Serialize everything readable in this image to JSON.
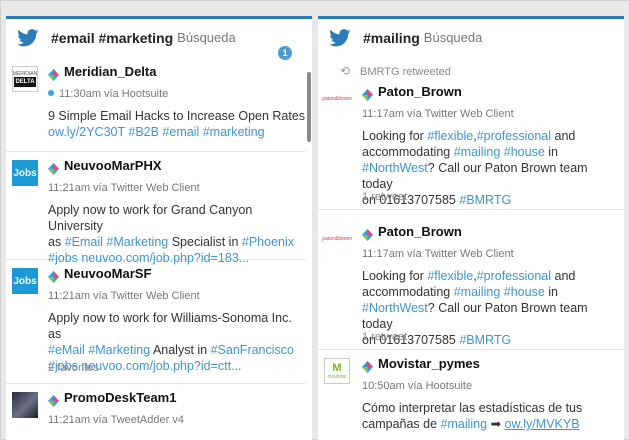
{
  "columns": [
    {
      "title": "#email #marketing",
      "subtitle": "Búsqueda",
      "badge": "1",
      "tweets": [
        {
          "author": "Meridian_Delta",
          "time": "11:30am vía Hootsuite",
          "body_plain": "9 Simple Email Hacks to Increase Open Rates ",
          "body_links": "ow.ly/2YC30T #B2B #email #marketing",
          "avatar_text": [
            "MERIDIAN",
            "DELTA"
          ]
        },
        {
          "author": "NeuvooMarPHX",
          "time": "11:21am vía Twitter Web Client",
          "body_line1": "Apply now to work for Grand Canyon University",
          "body_line2a": "as ",
          "body_link1": "#Email",
          "body_link2": "#Marketing",
          "body_line2b": " Specialist in ",
          "body_link3": "#Phoenix",
          "body_line3": "#jobs neuvoo.com/job.php?id=183...",
          "avatar_text": "Jobs"
        },
        {
          "author": "NeuvooMarSF",
          "time": "11:21am vía Twitter Web Client",
          "body_line1": "Apply now to work for Williams-Sonoma Inc. as",
          "body_link1": "#eMail",
          "body_link2": "#Marketing",
          "body_line2b": " Analyst in ",
          "body_link3": "#SanFrancisco",
          "body_line3": "#jobs neuvoo.com/job.php?id=ctt...",
          "footer": "2 favorites",
          "avatar_text": "Jobs"
        },
        {
          "author": "PromoDeskTeam1",
          "time": "11:21am vía TweetAdder v4"
        }
      ]
    },
    {
      "title": "#mailing",
      "subtitle": "Búsqueda",
      "retweet_label": "BMRTG retweeted",
      "tweets": [
        {
          "author": "Paton_Brown",
          "time": "11:17am vía Twitter Web Client",
          "l1a": "Looking for ",
          "l1b": "#flexible",
          "l1c": ",",
          "l1d": "#professional",
          "l1e": " and",
          "l2a": "accommodating ",
          "l2b": "#mailing",
          "l2c": " ",
          "l2d": "#house",
          "l2e": " in",
          "l3a": "#NorthWest",
          "l3b": "? Call our Paton Brown team today",
          "l4a": "on 01613707585 ",
          "l4b": "#BMRTG",
          "footer": "1 retweet",
          "avatar_text": "paton&brown"
        },
        {
          "author": "Paton_Brown",
          "time": "11:17am vía Twitter Web Client",
          "l1a": "Looking for ",
          "l1b": "#flexible",
          "l1c": ",",
          "l1d": "#professional",
          "l1e": " and",
          "l2a": "accommodating ",
          "l2b": "#mailing",
          "l2c": " ",
          "l2d": "#house",
          "l2e": " in",
          "l3a": "#NorthWest",
          "l3b": "? Call our Paton Brown team today",
          "l4a": "on 01613707585 ",
          "l4b": "#BMRTG",
          "footer": "1 retweet",
          "avatar_text": "paton&brown"
        },
        {
          "author": "Movistar_pymes",
          "time": "10:50am vía Hootsuite",
          "l1a": "Cómo interpretar las estadísticas de tus",
          "l2a": "campañas de ",
          "l2b": "#mailing",
          "l2c": " ➡ ",
          "l2d": "ow.ly/MVKYB",
          "avatar_text": "movistar"
        }
      ]
    }
  ],
  "colors": {
    "accent": "#2b7bb9",
    "link": "#3d95d0",
    "badge": "#4e9bd6"
  }
}
